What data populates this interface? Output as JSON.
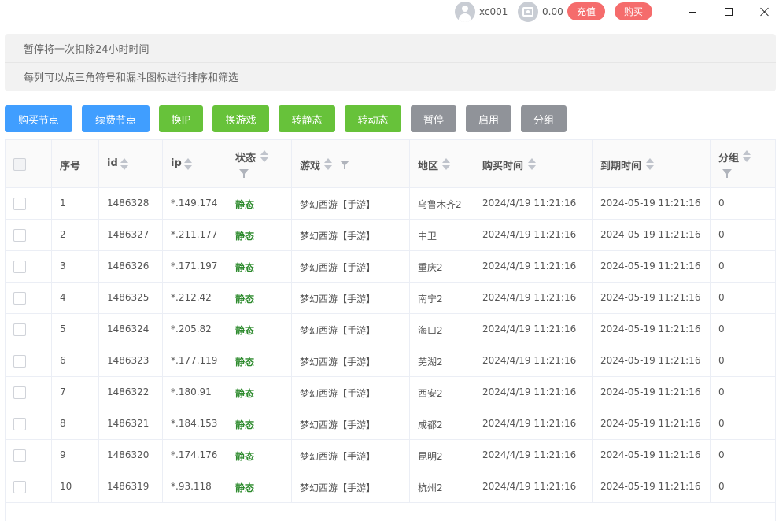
{
  "header": {
    "username": "xc001",
    "balance": "0.00",
    "recharge_label": "充值",
    "buy_label": "购买"
  },
  "notice": {
    "line1": "暂停将一次扣除24小时时间",
    "line2": "每列可以点三角符号和漏斗图标进行排序和筛选"
  },
  "toolbar": {
    "buy_node": "购买节点",
    "renew_node": "续费节点",
    "change_ip": "换IP",
    "change_game": "换游戏",
    "to_static": "转静态",
    "to_dynamic": "转动态",
    "pause": "暂停",
    "enable": "启用",
    "group": "分组"
  },
  "colors": {
    "blue": "#409eff",
    "green": "#67c23a",
    "gray": "#909399",
    "pill_red": "#f56c6c",
    "status_green": "#2e8b2e"
  },
  "table": {
    "columns": {
      "seq": "序号",
      "id": "id",
      "ip": "ip",
      "status": "状态",
      "game": "游戏",
      "region": "地区",
      "buy_time": "购买时间",
      "expire_time": "到期时间",
      "group": "分组"
    },
    "rows": [
      {
        "seq": "1",
        "id": "1486328",
        "ip": "*.149.174",
        "status": "静态",
        "game": "梦幻西游【手游】",
        "region": "乌鲁木齐2",
        "buy_time": "2024/4/19 11:21:16",
        "expire_time": "2024-05-19 11:21:16",
        "group": "0"
      },
      {
        "seq": "2",
        "id": "1486327",
        "ip": "*.211.177",
        "status": "静态",
        "game": "梦幻西游【手游】",
        "region": "中卫",
        "buy_time": "2024/4/19 11:21:16",
        "expire_time": "2024-05-19 11:21:16",
        "group": "0"
      },
      {
        "seq": "3",
        "id": "1486326",
        "ip": "*.171.197",
        "status": "静态",
        "game": "梦幻西游【手游】",
        "region": "重庆2",
        "buy_time": "2024/4/19 11:21:16",
        "expire_time": "2024-05-19 11:21:16",
        "group": "0"
      },
      {
        "seq": "4",
        "id": "1486325",
        "ip": "*.212.42",
        "status": "静态",
        "game": "梦幻西游【手游】",
        "region": "南宁2",
        "buy_time": "2024/4/19 11:21:16",
        "expire_time": "2024-05-19 11:21:16",
        "group": "0"
      },
      {
        "seq": "5",
        "id": "1486324",
        "ip": "*.205.82",
        "status": "静态",
        "game": "梦幻西游【手游】",
        "region": "海口2",
        "buy_time": "2024/4/19 11:21:16",
        "expire_time": "2024-05-19 11:21:16",
        "group": "0"
      },
      {
        "seq": "6",
        "id": "1486323",
        "ip": "*.177.119",
        "status": "静态",
        "game": "梦幻西游【手游】",
        "region": "芜湖2",
        "buy_time": "2024/4/19 11:21:16",
        "expire_time": "2024-05-19 11:21:16",
        "group": "0"
      },
      {
        "seq": "7",
        "id": "1486322",
        "ip": "*.180.91",
        "status": "静态",
        "game": "梦幻西游【手游】",
        "region": "西安2",
        "buy_time": "2024/4/19 11:21:16",
        "expire_time": "2024-05-19 11:21:16",
        "group": "0"
      },
      {
        "seq": "8",
        "id": "1486321",
        "ip": "*.184.153",
        "status": "静态",
        "game": "梦幻西游【手游】",
        "region": "成都2",
        "buy_time": "2024/4/19 11:21:16",
        "expire_time": "2024-05-19 11:21:16",
        "group": "0"
      },
      {
        "seq": "9",
        "id": "1486320",
        "ip": "*.174.176",
        "status": "静态",
        "game": "梦幻西游【手游】",
        "region": "昆明2",
        "buy_time": "2024/4/19 11:21:16",
        "expire_time": "2024-05-19 11:21:16",
        "group": "0"
      },
      {
        "seq": "10",
        "id": "1486319",
        "ip": "*.93.118",
        "status": "静态",
        "game": "梦幻西游【手游】",
        "region": "杭州2",
        "buy_time": "2024/4/19 11:21:16",
        "expire_time": "2024-05-19 11:21:16",
        "group": "0"
      }
    ]
  }
}
